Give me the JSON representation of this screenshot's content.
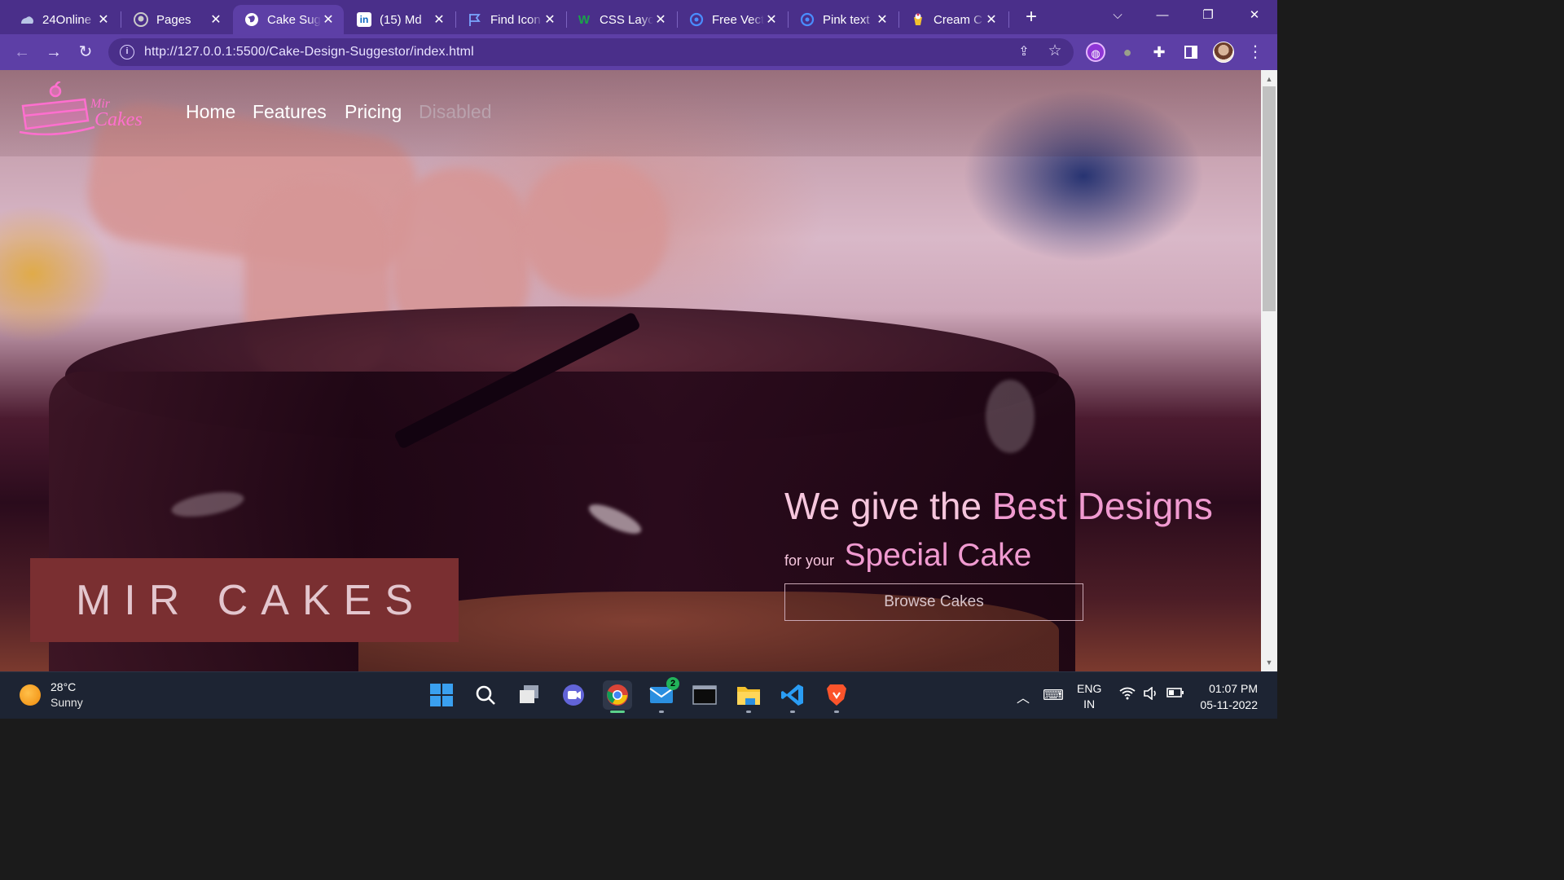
{
  "browser": {
    "tabs": [
      {
        "label": "24Online",
        "icon": "cloud-icon",
        "active": false
      },
      {
        "label": "Pages",
        "icon": "github-icon",
        "active": false
      },
      {
        "label": "Cake Sug",
        "icon": "globe-icon",
        "active": true
      },
      {
        "label": "(15) Md",
        "icon": "linkedin-icon",
        "active": false
      },
      {
        "label": "Find Icon",
        "icon": "flag-icon",
        "active": false
      },
      {
        "label": "CSS Layo",
        "icon": "w-icon",
        "active": false
      },
      {
        "label": "Free Vect",
        "icon": "vector-icon",
        "active": false
      },
      {
        "label": "Pink text",
        "icon": "vector-icon",
        "active": false
      },
      {
        "label": "Cream C",
        "icon": "cream-icon",
        "active": false
      }
    ],
    "new_tab": "+",
    "url": "http://127.0.0.1:5500/Cake-Design-Suggestor/index.html",
    "accent_color": "#5d3fa6"
  },
  "page": {
    "nav": {
      "home": "Home",
      "features": "Features",
      "pricing": "Pricing",
      "disabled": "Disabled"
    },
    "brand": "MIR CAKES",
    "headline_prefix": "We give the ",
    "headline_accent": "Best Designs",
    "subline_small": "for your",
    "subline_big": "Special Cake",
    "cta": "Browse Cakes",
    "accent_color": "#f09ad0"
  },
  "taskbar": {
    "temp": "28°C",
    "condition": "Sunny",
    "mail_badge": "2",
    "lang_top": "ENG",
    "lang_bottom": "IN",
    "time": "01:07 PM",
    "date": "05-11-2022"
  }
}
